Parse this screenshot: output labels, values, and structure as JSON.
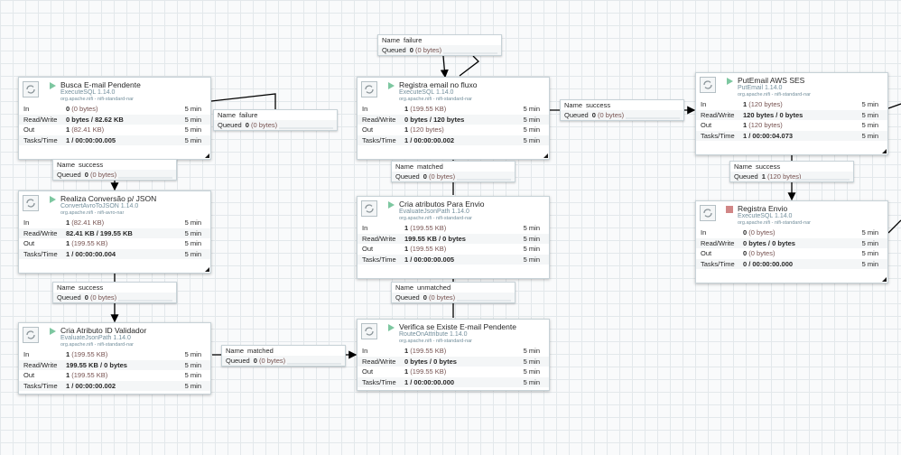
{
  "processors": {
    "busca": {
      "name": "Busca E-mail Pendente",
      "type": "ExecuteSQL 1.14.0",
      "bundle": "org.apache.nifi - nifi-standard-nar",
      "state": "running",
      "in_count": "0",
      "in_size": "(0 bytes)",
      "rw": "0 bytes / 82.62 KB",
      "out_count": "1",
      "out_size": "(82.41 KB)",
      "tasks": "1 / 00:00:00.005",
      "window": "5 min"
    },
    "realiza": {
      "name": "Realiza Conversão p/ JSON",
      "type": "ConvertAvroToJSON 1.14.0",
      "bundle": "org.apache.nifi - nifi-avro-nar",
      "state": "running",
      "in_count": "1",
      "in_size": "(82.41 KB)",
      "rw": "82.41 KB / 199.55 KB",
      "out_count": "1",
      "out_size": "(199.55 KB)",
      "tasks": "1 / 00:00:00.004",
      "window": "5 min"
    },
    "cria_id": {
      "name": "Cria Atributo ID Validador",
      "type": "EvaluateJsonPath 1.14.0",
      "bundle": "org.apache.nifi - nifi-standard-nar",
      "state": "running",
      "in_count": "1",
      "in_size": "(199.55 KB)",
      "rw": "199.55 KB / 0 bytes",
      "out_count": "1",
      "out_size": "(199.55 KB)",
      "tasks": "1 / 00:00:00.002",
      "window": "5 min"
    },
    "registra_fluxo": {
      "name": "Registra email no fluxo",
      "type": "ExecuteSQL 1.14.0",
      "bundle": "org.apache.nifi - nifi-standard-nar",
      "state": "running",
      "in_count": "1",
      "in_size": "(199.55 KB)",
      "rw": "0 bytes / 120 bytes",
      "out_count": "1",
      "out_size": "(120 bytes)",
      "tasks": "1 / 00:00:00.002",
      "window": "5 min"
    },
    "cria_envio": {
      "name": "Cria atributos Para Envio",
      "type": "EvaluateJsonPath 1.14.0",
      "bundle": "org.apache.nifi - nifi-standard-nar",
      "state": "running",
      "in_count": "1",
      "in_size": "(199.55 KB)",
      "rw": "199.55 KB / 0 bytes",
      "out_count": "1",
      "out_size": "(199.55 KB)",
      "tasks": "1 / 00:00:00.005",
      "window": "5 min"
    },
    "verifica": {
      "name": "Verifica se Existe E-mail Pendente",
      "type": "RouteOnAttribute 1.14.0",
      "bundle": "org.apache.nifi - nifi-standard-nar",
      "state": "running",
      "in_count": "1",
      "in_size": "(199.55 KB)",
      "rw": "0 bytes / 0 bytes",
      "out_count": "1",
      "out_size": "(199.55 KB)",
      "tasks": "1 / 00:00:00.000",
      "window": "5 min"
    },
    "putemail": {
      "name": "PutEmail AWS SES",
      "type": "PutEmail 1.14.0",
      "bundle": "org.apache.nifi - nifi-standard-nar",
      "state": "running",
      "in_count": "1",
      "in_size": "(120 bytes)",
      "rw": "120 bytes / 0 bytes",
      "out_count": "1",
      "out_size": "(120 bytes)",
      "tasks": "1 / 00:00:04.073",
      "window": "5 min"
    },
    "registra_envio": {
      "name": "Registra Envio",
      "type": "ExecuteSQL 1.14.0",
      "bundle": "org.apache.nifi - nifi-standard-nar",
      "state": "stopped",
      "in_count": "0",
      "in_size": "(0 bytes)",
      "rw": "0 bytes / 0 bytes",
      "out_count": "0",
      "out_size": "(0 bytes)",
      "tasks": "0 / 00:00:00.000",
      "window": "5 min"
    }
  },
  "row_labels": {
    "in": "In",
    "rw": "Read/Write",
    "out": "Out",
    "tasks": "Tasks/Time"
  },
  "connections": {
    "failure_top": {
      "name_label": "Name",
      "name": "failure",
      "queued_label": "Queued",
      "count": "0",
      "size": "(0 bytes)"
    },
    "failure_busca": {
      "name_label": "Name",
      "name": "failure",
      "queued_label": "Queued",
      "count": "0",
      "size": "(0 bytes)"
    },
    "success_busca": {
      "name_label": "Name",
      "name": "success",
      "queued_label": "Queued",
      "count": "0",
      "size": "(0 bytes)"
    },
    "success_realiza": {
      "name_label": "Name",
      "name": "success",
      "queued_label": "Queued",
      "count": "0",
      "size": "(0 bytes)"
    },
    "matched_cria": {
      "name_label": "Name",
      "name": "matched",
      "queued_label": "Queued",
      "count": "0",
      "size": "(0 bytes)"
    },
    "success_registra": {
      "name_label": "Name",
      "name": "success",
      "queued_label": "Queued",
      "count": "0",
      "size": "(0 bytes)"
    },
    "matched_envio": {
      "name_label": "Name",
      "name": "matched",
      "queued_label": "Queued",
      "count": "0",
      "size": "(0 bytes)"
    },
    "unmatched": {
      "name_label": "Name",
      "name": "unmatched",
      "queued_label": "Queued",
      "count": "0",
      "size": "(0 bytes)"
    },
    "success_put": {
      "name_label": "Name",
      "name": "success",
      "queued_label": "Queued",
      "count": "1",
      "size": "(120 bytes)"
    }
  }
}
